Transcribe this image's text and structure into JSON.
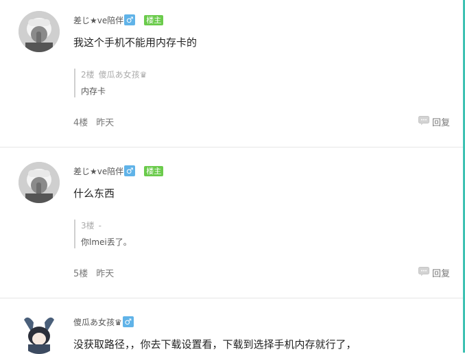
{
  "posts": [
    {
      "username": "差じ★ve陪伴",
      "gender": "♂",
      "owner_badge": "楼主",
      "content": "我这个手机不能用内存卡的",
      "quote": {
        "floor": "2楼",
        "author": "傻瓜あ女孩♛",
        "text": "内存卡"
      },
      "floor": "4楼",
      "time": "昨天",
      "reply_label": "回复"
    },
    {
      "username": "差じ★ve陪伴",
      "gender": "♂",
      "owner_badge": "楼主",
      "content": "什么东西",
      "quote": {
        "floor": "3楼",
        "author": "-",
        "text": "你lmei丢了。"
      },
      "floor": "5楼",
      "time": "昨天",
      "reply_label": "回复"
    },
    {
      "username": "傻瓜あ女孩♛",
      "gender": "♂",
      "content": "没获取路径，，你去下载设置看，下载到选择手机内存就行了，"
    }
  ],
  "colors": {
    "accent": "#3ec1b2",
    "owner_badge": "#6bcb4c",
    "gender": "#60b3e8"
  },
  "icons": {
    "reply": "comment-icon",
    "avatar1": "user-avatar",
    "avatar3": "anime-avatar"
  }
}
